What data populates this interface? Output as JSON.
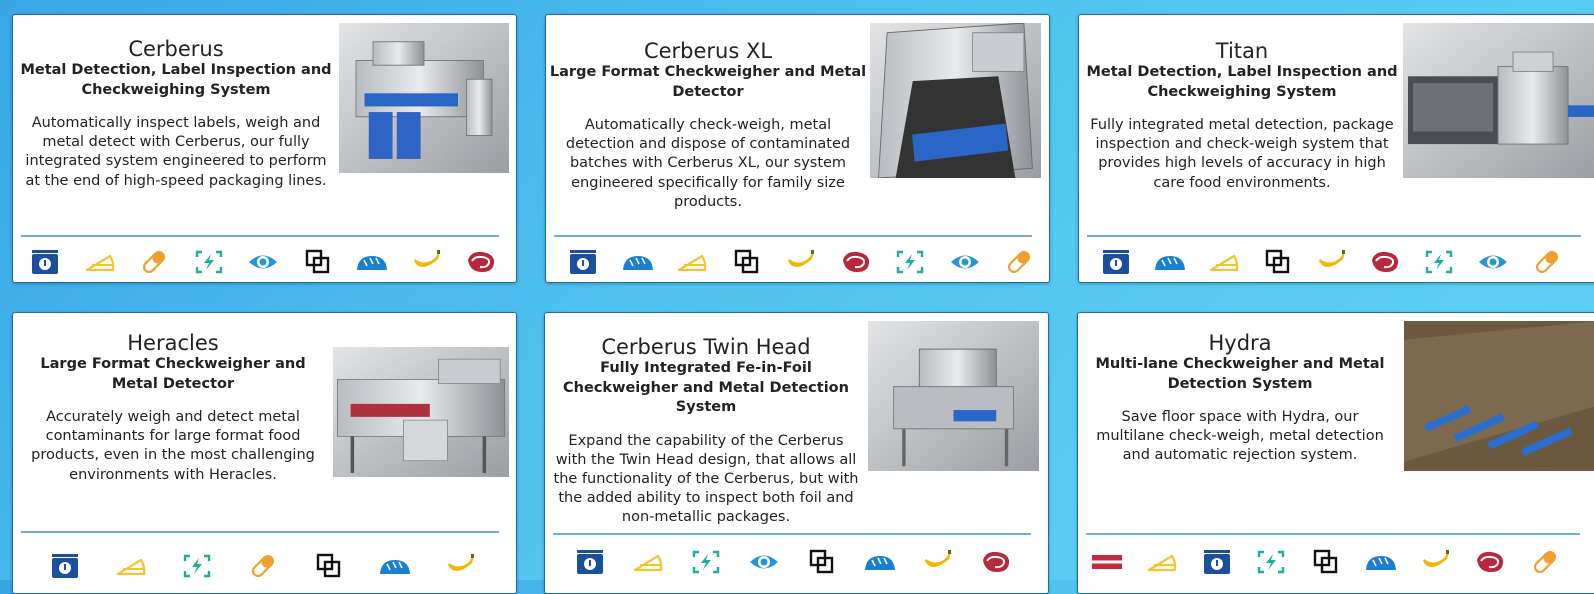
{
  "colors": {
    "scale": "#1c4f9c",
    "cheese": "#f4c430",
    "capsule": "#f0a030",
    "metal": "#1fae9a",
    "eye": "#2496d8",
    "package": "#111111",
    "bread": "#1a7fcf",
    "banana": "#f2b705",
    "meat": "#b8283c",
    "label": "#c8283c"
  },
  "cards": [
    {
      "title": "Cerberus",
      "subtitle": "Metal Detection, Label Inspection and Checkweighing System",
      "description": "Automatically inspect labels, weigh and metal detect with Cerberus, our fully integrated system engineered to perform at the end of high-speed packaging lines.",
      "image": "cerberus-machine-photo",
      "icons": [
        "scale-icon",
        "cheese-icon",
        "capsule-icon",
        "metal-detection-icon",
        "eye-icon",
        "package-icon",
        "bread-icon",
        "banana-icon",
        "meat-icon"
      ]
    },
    {
      "title": "Cerberus XL",
      "subtitle": "Large Format Checkweigher and Metal Detector",
      "description": "Automatically check-weigh, metal detection and dispose of contaminated batches with Cerberus XL, our system engineered specifically for family size products.",
      "image": "cerberus-xl-machine-photo",
      "icons": [
        "scale-icon",
        "bread-icon",
        "cheese-icon",
        "package-icon",
        "banana-icon",
        "meat-icon",
        "metal-detection-icon",
        "eye-icon",
        "capsule-icon"
      ]
    },
    {
      "title": "Titan",
      "subtitle": "Metal Detection, Label Inspection and Checkweighing System",
      "description": "Fully integrated metal detection, package inspection and check-weigh system that provides high levels of accuracy in high care food environments.",
      "image": "titan-machine-photo",
      "icons": [
        "scale-icon",
        "bread-icon",
        "cheese-icon",
        "package-icon",
        "banana-icon",
        "meat-icon",
        "metal-detection-icon",
        "eye-icon",
        "capsule-icon"
      ]
    },
    {
      "title": "Heracles",
      "subtitle": "Large Format Checkweigher and Metal Detector",
      "description": "Accurately weigh and detect metal contaminants for large format food products, even in the most challenging environments with Heracles.",
      "image": "heracles-machine-photo",
      "icons": [
        "scale-icon",
        "cheese-icon",
        "metal-detection-icon",
        "capsule-icon",
        "package-icon",
        "bread-icon",
        "banana-icon"
      ]
    },
    {
      "title": "Cerberus Twin Head",
      "subtitle": "Fully Integrated Fe-in-Foil Checkweigher and Metal Detection System",
      "description": "Expand the capability of the Cerberus with the Twin Head design, that allows all the functionality of the Cerberus, but with the added ability to inspect both foil and non-metallic packages.",
      "image": "cerberus-twin-head-machine-photo",
      "icons": [
        "scale-icon",
        "cheese-icon",
        "metal-detection-icon",
        "eye-icon",
        "package-icon",
        "bread-icon",
        "banana-icon",
        "meat-icon"
      ]
    },
    {
      "title": "Hydra",
      "subtitle": "Multi-lane Checkweigher and Metal Detection System",
      "description": "Save floor space with Hydra, our multilane check-weigh, metal detection and automatic rejection system.",
      "image": "hydra-machine-photo",
      "icons": [
        "label-icon",
        "cheese-icon",
        "scale-icon",
        "metal-detection-icon",
        "package-icon",
        "bread-icon",
        "banana-icon",
        "meat-icon",
        "capsule-icon"
      ]
    }
  ]
}
